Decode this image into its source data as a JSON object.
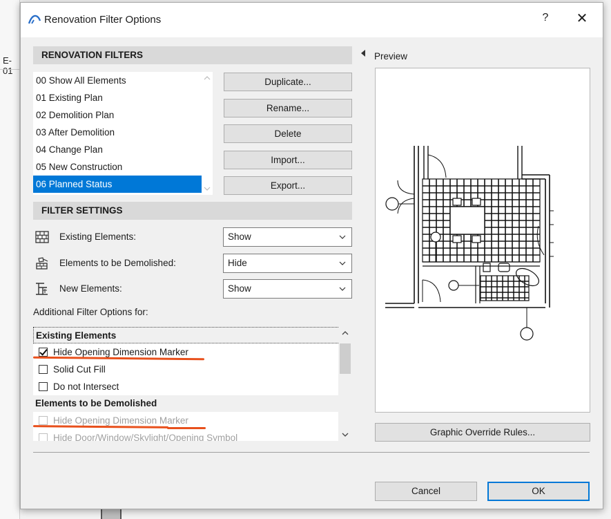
{
  "background": {
    "left_label": "E-01"
  },
  "dialog": {
    "title": "Renovation Filter Options",
    "help_label": "?",
    "close_label": "✕"
  },
  "filters": {
    "header": "RENOVATION FILTERS",
    "items": [
      "00 Show All Elements",
      "01 Existing Plan",
      "02 Demolition Plan",
      "03 After Demolition",
      "04 Change Plan",
      "05 New Construction",
      "06 Planned Status"
    ],
    "selected_index": 6,
    "buttons": {
      "duplicate": "Duplicate...",
      "rename": "Rename...",
      "delete": "Delete",
      "import": "Import...",
      "export": "Export..."
    }
  },
  "settings": {
    "header": "FILTER SETTINGS",
    "rows": [
      {
        "label": "Existing Elements:",
        "value": "Show",
        "icon": "brick-wall-icon"
      },
      {
        "label": "Elements to be Demolished:",
        "value": "Hide",
        "icon": "demolish-icon"
      },
      {
        "label": "New Elements:",
        "value": "Show",
        "icon": "new-element-icon"
      }
    ]
  },
  "additional": {
    "label": "Additional Filter Options for:",
    "groups": [
      {
        "title": "Existing Elements",
        "options": [
          {
            "label": "Hide Opening Dimension Marker",
            "checked": true,
            "disabled": false
          },
          {
            "label": "Solid Cut Fill",
            "checked": false,
            "disabled": false
          },
          {
            "label": "Do not Intersect",
            "checked": false,
            "disabled": false
          }
        ]
      },
      {
        "title": "Elements to be Demolished",
        "options": [
          {
            "label": "Hide Opening Dimension Marker",
            "checked": false,
            "disabled": true
          },
          {
            "label": "Hide Door/Window/Skylight/Opening Symbol",
            "checked": false,
            "disabled": true
          }
        ]
      }
    ]
  },
  "preview": {
    "label": "Preview"
  },
  "footer": {
    "graphic_override": "Graphic Override Rules...",
    "cancel": "Cancel",
    "ok": "OK"
  },
  "colors": {
    "accent": "#0078d7",
    "annotation": "#e8501c"
  }
}
